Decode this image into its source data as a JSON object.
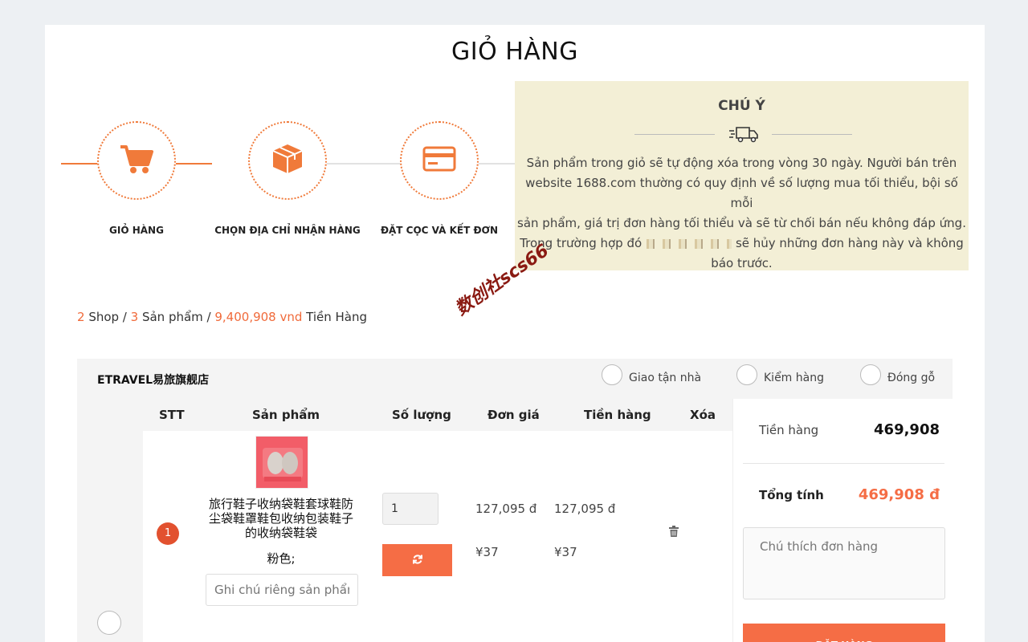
{
  "page": {
    "title": "GIỎ HÀNG"
  },
  "steps": [
    {
      "label": "GIỎ HÀNG",
      "icon": "cart-icon"
    },
    {
      "label": "CHỌN ĐỊA CHỈ NHẬN HÀNG",
      "icon": "box-icon"
    },
    {
      "label": "ĐẶT CỌC VÀ KẾT ĐƠN",
      "icon": "card-icon"
    }
  ],
  "notice": {
    "title": "CHÚ Ý",
    "icon": "truck-icon",
    "lines": [
      "Sản phẩm trong giỏ sẽ tự động xóa trong vòng 30 ngày. Người bán trên",
      "website 1688.com thường có quy định về số lượng mua tối thiểu, bội số mỗi",
      "sản phẩm, giá trị đơn hàng tối thiểu và sẽ từ chối bán nếu không đáp ứng.",
      "Trong trường hợp đó",
      "sẽ hủy những đơn hàng này và không",
      "báo trước."
    ]
  },
  "watermark": "数创社scs66",
  "summary": {
    "shops": "2",
    "shops_label": " Shop / ",
    "products": "3",
    "products_label": " Sản phẩm / ",
    "total": "9,400,908 vnd",
    "total_label": " Tiền Hàng"
  },
  "shop": {
    "name": "ETRAVEL易旅旗舰店",
    "options": [
      "Giao tận nhà",
      "Kiểm hàng",
      "Đóng gỗ"
    ]
  },
  "table": {
    "headers": [
      "STT",
      "Sản phẩm",
      "Số lượng",
      "Đơn giá",
      "Tiền hàng",
      "Xóa"
    ]
  },
  "item": {
    "index": "1",
    "name": "旅行鞋子收纳袋鞋套球鞋防尘袋鞋罩鞋包收纳包装鞋子的收纳袋鞋袋",
    "variant": "粉色;",
    "note_placeholder": "Ghi chú riêng sản phẩm",
    "quantity": "1",
    "unit_price_vnd": "127,095 đ",
    "unit_price_cny": "¥37",
    "total_vnd": "127,095 đ",
    "total_cny": "¥37"
  },
  "side": {
    "subtotal_label": "Tiền hàng",
    "subtotal_value": "469,908",
    "total_label": "Tổng tính",
    "total_value": "469,908 đ",
    "comment_placeholder": "Chú thích đơn hàng",
    "order_button": "ĐẶT HÀNG"
  },
  "colors": {
    "accent": "#f56d45",
    "notice_bg": "#f3efd6",
    "badge": "#e2512f"
  }
}
